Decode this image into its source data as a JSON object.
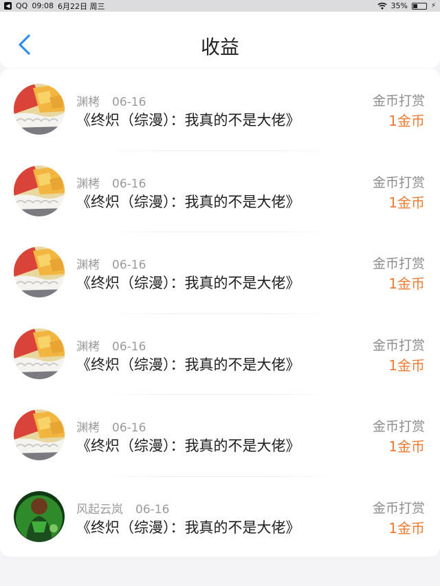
{
  "status_bar": {
    "app": "QQ",
    "time": "09:08",
    "date": "6月22日 周三",
    "battery": "35%",
    "battery_level": 0.35
  },
  "header": {
    "title": "收益"
  },
  "colors": {
    "accent_back": "#2f8ff0",
    "amount": "#ef7a30"
  },
  "records": [
    {
      "user": "渊栲",
      "date": "06-16",
      "book": "《终炽（综漫）：我真的不是大佬》",
      "type": "金币打赏",
      "amount": "1金币",
      "avatar": "fruit-cake-avatar"
    },
    {
      "user": "渊栲",
      "date": "06-16",
      "book": "《终炽（综漫）：我真的不是大佬》",
      "type": "金币打赏",
      "amount": "1金币",
      "avatar": "fruit-cake-avatar"
    },
    {
      "user": "渊栲",
      "date": "06-16",
      "book": "《终炽（综漫）：我真的不是大佬》",
      "type": "金币打赏",
      "amount": "1金币",
      "avatar": "fruit-cake-avatar"
    },
    {
      "user": "渊栲",
      "date": "06-16",
      "book": "《终炽（综漫）：我真的不是大佬》",
      "type": "金币打赏",
      "amount": "1金币",
      "avatar": "fruit-cake-avatar"
    },
    {
      "user": "渊栲",
      "date": "06-16",
      "book": "《终炽（综漫）：我真的不是大佬》",
      "type": "金币打赏",
      "amount": "1金币",
      "avatar": "fruit-cake-avatar"
    },
    {
      "user": "风起云岚",
      "date": "06-16",
      "book": "《终炽（综漫）：我真的不是大佬》",
      "type": "金币打赏",
      "amount": "1金币",
      "avatar": "green-character-avatar"
    }
  ]
}
